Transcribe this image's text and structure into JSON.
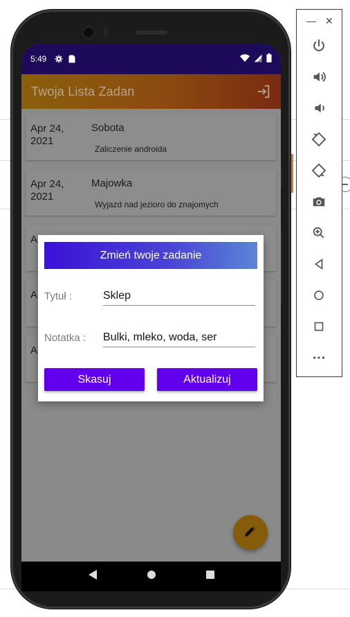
{
  "status_bar": {
    "time": "5:49",
    "icons": [
      "gear-icon",
      "sd-card-icon"
    ],
    "right_icons": [
      "wifi-icon",
      "signal-icon",
      "battery-icon"
    ]
  },
  "app_bar": {
    "title": "Twoja Lista Zadan",
    "action_icon": "logout-icon"
  },
  "tasks": [
    {
      "date": "Apr 24, 2021",
      "title": "Sobota",
      "note": "Zaliczenie androida"
    },
    {
      "date": "Apr 24, 2021",
      "title": "Majowka",
      "note": "Wyjazd nad jezioro do znajomych"
    },
    {
      "date": "A 2",
      "title": "",
      "note": ""
    },
    {
      "date": "A 2",
      "title": "",
      "note": ""
    },
    {
      "date": "A 2",
      "title": "",
      "note": ""
    }
  ],
  "dialog": {
    "title": "Zmień twoje zadanie",
    "title_label": "Tytuł :",
    "title_value": "Sklep",
    "note_label": "Notatka :",
    "note_value": "Bulki, mleko, woda, ser",
    "delete_button": "Skasuj",
    "update_button": "Aktualizuj"
  },
  "fab_icon": "edit-icon",
  "nav_bar": [
    "back-icon",
    "home-icon",
    "recents-icon"
  ],
  "emulator_toolbar": {
    "window_controls": [
      "—",
      "✕"
    ],
    "tools": [
      "power-icon",
      "volume-up-icon",
      "volume-down-icon",
      "rotate-left-icon",
      "rotate-right-icon",
      "camera-icon",
      "zoom-icon",
      "back-icon",
      "home-icon",
      "overview-icon",
      "more-icon"
    ]
  },
  "colors": {
    "status_bar": "#1e0a5a",
    "app_bar_start": "#8a5f0c",
    "app_bar_end": "#7a2a10",
    "dialog_button": "#6200ee",
    "dialog_header_start": "#3a12d8",
    "dialog_header_end": "#5a86d6",
    "fab": "#855d0a"
  }
}
